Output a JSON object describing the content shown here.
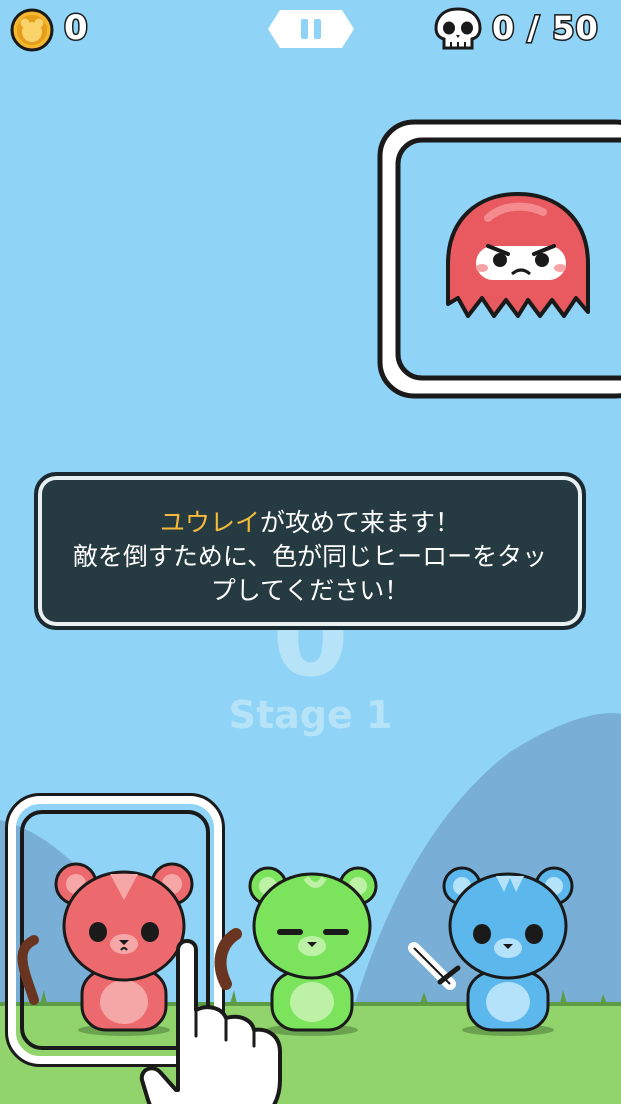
{
  "hud": {
    "coins": "0",
    "kills": "0 / 50"
  },
  "dialog": {
    "line1_highlight": "ユウレイ",
    "line1_rest": "が攻めて来ます！",
    "line2": "敵を倒すために、色が同じヒーローをタッ",
    "line3": "プしてください！"
  },
  "stage": {
    "number": "0",
    "label": "Stage 1"
  },
  "enemy": {
    "name": "ghost",
    "color": "#e85a5f"
  },
  "heroes": [
    {
      "name": "red-bear",
      "color": "#ec6a6d",
      "weapon": "staff",
      "selected": true
    },
    {
      "name": "green-bear",
      "color": "#7be35c",
      "weapon": "club"
    },
    {
      "name": "blue-bear",
      "color": "#5cb7ec",
      "weapon": "sword"
    }
  ],
  "colors": {
    "sky": "#8fd3f6",
    "grass": "#8fd36a",
    "hill": "#7ab0d8",
    "dialog_bg": "#263a42",
    "highlight": "#f5b93b"
  }
}
